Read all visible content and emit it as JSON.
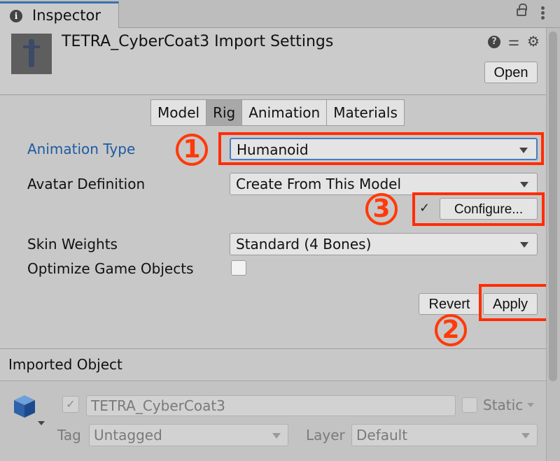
{
  "tab": {
    "label": "Inspector"
  },
  "header": {
    "title": "TETRA_CyberCoat3 Import Settings",
    "help_glyph": "?",
    "open_label": "Open"
  },
  "rig_tabs": [
    {
      "label": "Model",
      "active": false
    },
    {
      "label": "Rig",
      "active": true
    },
    {
      "label": "Animation",
      "active": false
    },
    {
      "label": "Materials",
      "active": false
    }
  ],
  "fields": {
    "animation_type": {
      "label": "Animation Type",
      "value": "Humanoid"
    },
    "avatar_definition": {
      "label": "Avatar Definition",
      "value": "Create From This Model"
    },
    "configure": {
      "check": "✓",
      "label": "Configure..."
    },
    "skin_weights": {
      "label": "Skin Weights",
      "value": "Standard (4 Bones)"
    },
    "optimize_game_objects": {
      "label": "Optimize Game Objects",
      "checked": false
    }
  },
  "actions": {
    "revert_label": "Revert",
    "apply_label": "Apply"
  },
  "annotations": {
    "one": "1",
    "two": "2",
    "three": "3",
    "color": "#ff2d07"
  },
  "imported_object": {
    "section_title": "Imported Object",
    "active_check": "✓",
    "name": "TETRA_CyberCoat3",
    "static_label": "Static",
    "tag_label": "Tag",
    "tag_value": "Untagged",
    "layer_label": "Layer",
    "layer_value": "Default"
  },
  "icons": [
    "info-icon",
    "lock-icon",
    "kebab-menu-icon",
    "help-icon",
    "sliders-icon",
    "gear-icon",
    "dropdown-arrow-icon",
    "cube-icon"
  ]
}
